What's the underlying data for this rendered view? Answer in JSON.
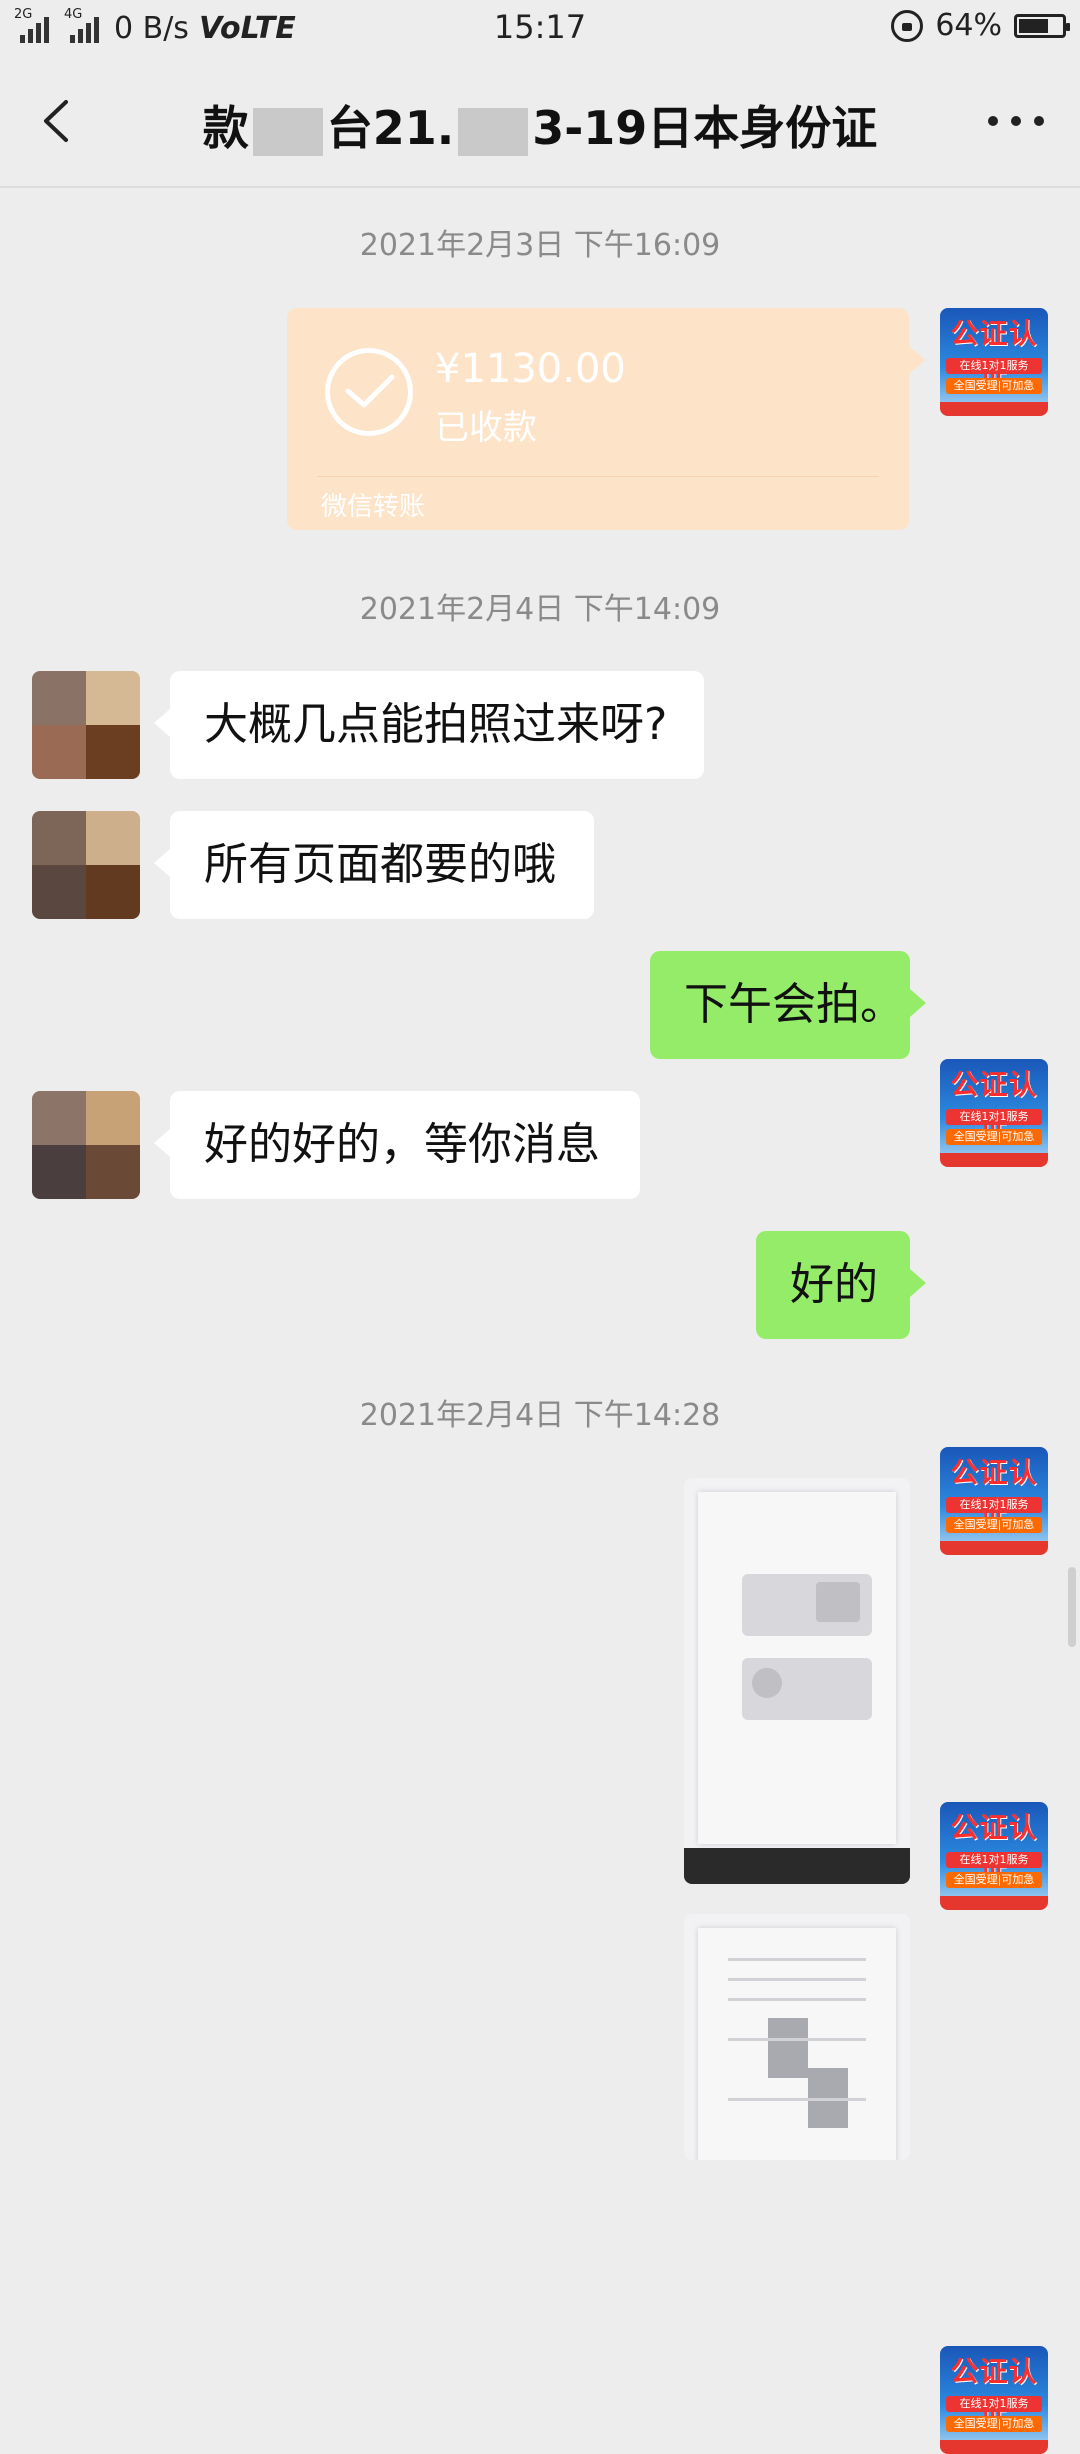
{
  "status_bar": {
    "signal_1_tag": "2G",
    "signal_2_tag": "4G",
    "network_speed": "0 B/s",
    "volte": "VoLTE",
    "time": "15:17",
    "battery": "64%"
  },
  "header": {
    "title_part1": "款",
    "title_part2": "台21.",
    "title_part3": "3-19日本身份证"
  },
  "messages": {
    "ts1": "2021年2月3日 下午16:09",
    "transfer": {
      "amount": "¥1130.00",
      "status": "已收款",
      "label": "微信转账"
    },
    "ts2": "2021年2月4日 下午14:09",
    "in1": "大概几点能拍照过来呀?",
    "in2": "所有页面都要的哦",
    "out1": "下午会拍。",
    "in3": "好的好的，等你消息",
    "out2": "好的",
    "ts3": "2021年2月4日 下午14:28"
  },
  "avatar_notary": {
    "title": "公证认证",
    "line1": "在线1对1服务",
    "line2": "全国受理|可加急"
  },
  "colors": {
    "out_bubble": "#95ec69",
    "transfer": "#fde3c8",
    "background": "#ededed"
  }
}
